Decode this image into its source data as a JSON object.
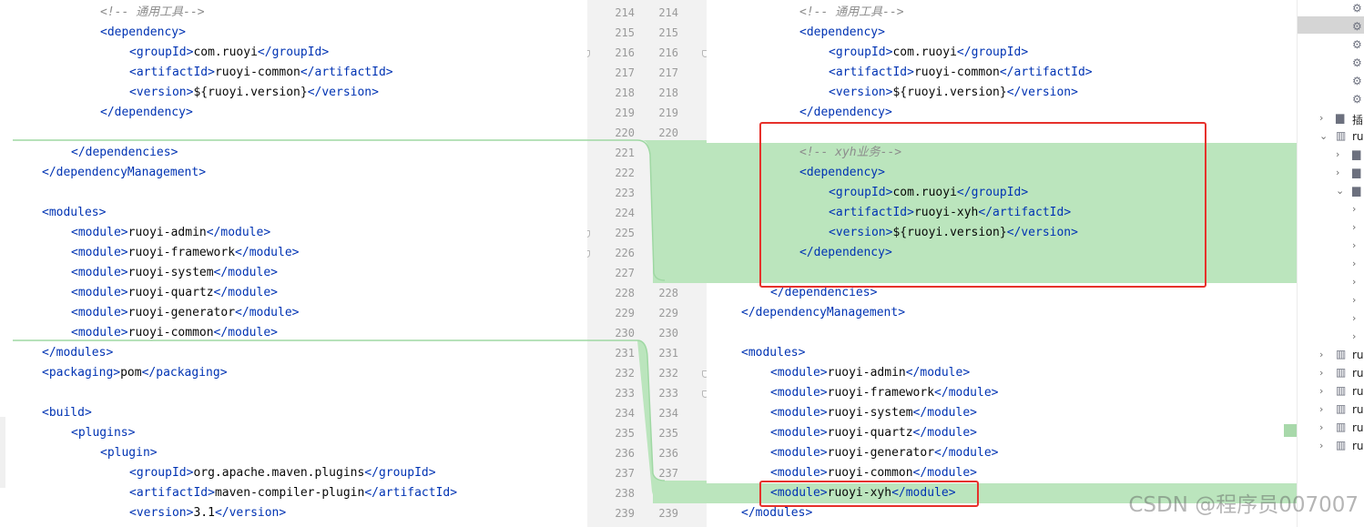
{
  "left_lines": [
    {
      "n": 214,
      "indent": 2,
      "parts": [
        [
          "cm",
          "<!-- 通用工具-->"
        ]
      ]
    },
    {
      "n": 215,
      "indent": 2,
      "parts": [
        [
          "t",
          "<"
        ],
        [
          "t",
          "dependency"
        ],
        [
          "t",
          ">"
        ]
      ]
    },
    {
      "n": 216,
      "indent": 3,
      "parts": [
        [
          "t",
          "<"
        ],
        [
          "t",
          "groupId"
        ],
        [
          "t",
          ">"
        ],
        [
          "p",
          "com.ruoyi"
        ],
        [
          "t",
          "</"
        ],
        [
          "t",
          "groupId"
        ],
        [
          "t",
          ">"
        ]
      ]
    },
    {
      "n": 217,
      "indent": 3,
      "parts": [
        [
          "t",
          "<"
        ],
        [
          "t",
          "artifactId"
        ],
        [
          "t",
          ">"
        ],
        [
          "p",
          "ruoyi-common"
        ],
        [
          "t",
          "</"
        ],
        [
          "t",
          "artifactId"
        ],
        [
          "t",
          ">"
        ]
      ]
    },
    {
      "n": 218,
      "indent": 3,
      "parts": [
        [
          "t",
          "<"
        ],
        [
          "t",
          "version"
        ],
        [
          "t",
          ">"
        ],
        [
          "p",
          "${ruoyi.version}"
        ],
        [
          "t",
          "</"
        ],
        [
          "t",
          "version"
        ],
        [
          "t",
          ">"
        ]
      ]
    },
    {
      "n": 219,
      "indent": 2,
      "parts": [
        [
          "t",
          "</"
        ],
        [
          "t",
          "dependency"
        ],
        [
          "t",
          ">"
        ]
      ]
    },
    {
      "n": 220,
      "indent": 0,
      "parts": []
    },
    {
      "n": 221,
      "indent": 1,
      "parts": [
        [
          "t",
          "</"
        ],
        [
          "t",
          "dependencies"
        ],
        [
          "t",
          ">"
        ]
      ]
    },
    {
      "n": 222,
      "indent": 0,
      "parts": [
        [
          "t",
          "</"
        ],
        [
          "t",
          "dependencyManagement"
        ],
        [
          "t",
          ">"
        ]
      ]
    },
    {
      "n": 223,
      "indent": 0,
      "parts": []
    },
    {
      "n": 224,
      "indent": 0,
      "parts": [
        [
          "t",
          "<"
        ],
        [
          "t",
          "modules"
        ],
        [
          "t",
          ">"
        ]
      ]
    },
    {
      "n": 225,
      "indent": 1,
      "parts": [
        [
          "t",
          "<"
        ],
        [
          "t",
          "module"
        ],
        [
          "t",
          ">"
        ],
        [
          "p",
          "ruoyi-admin"
        ],
        [
          "t",
          "</"
        ],
        [
          "t",
          "module"
        ],
        [
          "t",
          ">"
        ]
      ]
    },
    {
      "n": 226,
      "indent": 1,
      "parts": [
        [
          "t",
          "<"
        ],
        [
          "t",
          "module"
        ],
        [
          "t",
          ">"
        ],
        [
          "p",
          "ruoyi-framework"
        ],
        [
          "t",
          "</"
        ],
        [
          "t",
          "module"
        ],
        [
          "t",
          ">"
        ]
      ]
    },
    {
      "n": 227,
      "indent": 1,
      "parts": [
        [
          "t",
          "<"
        ],
        [
          "t",
          "module"
        ],
        [
          "t",
          ">"
        ],
        [
          "p",
          "ruoyi-system"
        ],
        [
          "t",
          "</"
        ],
        [
          "t",
          "module"
        ],
        [
          "t",
          ">"
        ]
      ]
    },
    {
      "n": 228,
      "indent": 1,
      "parts": [
        [
          "t",
          "<"
        ],
        [
          "t",
          "module"
        ],
        [
          "t",
          ">"
        ],
        [
          "p",
          "ruoyi-quartz"
        ],
        [
          "t",
          "</"
        ],
        [
          "t",
          "module"
        ],
        [
          "t",
          ">"
        ]
      ]
    },
    {
      "n": 229,
      "indent": 1,
      "parts": [
        [
          "t",
          "<"
        ],
        [
          "t",
          "module"
        ],
        [
          "t",
          ">"
        ],
        [
          "p",
          "ruoyi-generator"
        ],
        [
          "t",
          "</"
        ],
        [
          "t",
          "module"
        ],
        [
          "t",
          ">"
        ]
      ]
    },
    {
      "n": 230,
      "indent": 1,
      "parts": [
        [
          "t",
          "<"
        ],
        [
          "t",
          "module"
        ],
        [
          "t",
          ">"
        ],
        [
          "p",
          "ruoyi-common"
        ],
        [
          "t",
          "</"
        ],
        [
          "t",
          "module"
        ],
        [
          "t",
          ">"
        ]
      ]
    },
    {
      "n": 231,
      "indent": 0,
      "parts": [
        [
          "t",
          "</"
        ],
        [
          "t",
          "modules"
        ],
        [
          "t",
          ">"
        ]
      ]
    },
    {
      "n": 232,
      "indent": 0,
      "parts": [
        [
          "t",
          "<"
        ],
        [
          "t",
          "packaging"
        ],
        [
          "t",
          ">"
        ],
        [
          "p",
          "pom"
        ],
        [
          "t",
          "</"
        ],
        [
          "t",
          "packaging"
        ],
        [
          "t",
          ">"
        ]
      ]
    },
    {
      "n": 233,
      "indent": 0,
      "parts": []
    },
    {
      "n": 234,
      "indent": 0,
      "parts": [
        [
          "t",
          "<"
        ],
        [
          "t",
          "build"
        ],
        [
          "t",
          ">"
        ]
      ]
    },
    {
      "n": 235,
      "indent": 1,
      "parts": [
        [
          "t",
          "<"
        ],
        [
          "t",
          "plugins"
        ],
        [
          "t",
          ">"
        ]
      ]
    },
    {
      "n": 236,
      "indent": 2,
      "parts": [
        [
          "t",
          "<"
        ],
        [
          "t",
          "plugin"
        ],
        [
          "t",
          ">"
        ]
      ]
    },
    {
      "n": 237,
      "indent": 3,
      "parts": [
        [
          "t",
          "<"
        ],
        [
          "t",
          "groupId"
        ],
        [
          "t",
          ">"
        ],
        [
          "p",
          "org.apache.maven.plugins"
        ],
        [
          "t",
          "</"
        ],
        [
          "t",
          "groupId"
        ],
        [
          "t",
          ">"
        ]
      ]
    },
    {
      "n": 238,
      "indent": 3,
      "parts": [
        [
          "t",
          "<"
        ],
        [
          "t",
          "artifactId"
        ],
        [
          "t",
          ">"
        ],
        [
          "p",
          "maven-compiler-plugin"
        ],
        [
          "t",
          "</"
        ],
        [
          "t",
          "artifactId"
        ],
        [
          "t",
          ">"
        ]
      ]
    },
    {
      "n": 239,
      "indent": 3,
      "parts": [
        [
          "t",
          "<"
        ],
        [
          "t",
          "version"
        ],
        [
          "t",
          ">"
        ],
        [
          "p",
          "3.1"
        ],
        [
          "t",
          "</"
        ],
        [
          "t",
          "version"
        ],
        [
          "t",
          ">"
        ]
      ]
    }
  ],
  "right_lines": [
    {
      "n": 214,
      "indent": 2,
      "parts": [
        [
          "cm",
          "<!-- 通用工具-->"
        ]
      ]
    },
    {
      "n": 215,
      "indent": 2,
      "parts": [
        [
          "t",
          "<"
        ],
        [
          "t",
          "dependency"
        ],
        [
          "t",
          ">"
        ]
      ]
    },
    {
      "n": 216,
      "indent": 3,
      "parts": [
        [
          "t",
          "<"
        ],
        [
          "t",
          "groupId"
        ],
        [
          "t",
          ">"
        ],
        [
          "p",
          "com.ruoyi"
        ],
        [
          "t",
          "</"
        ],
        [
          "t",
          "groupId"
        ],
        [
          "t",
          ">"
        ]
      ]
    },
    {
      "n": 217,
      "indent": 3,
      "parts": [
        [
          "t",
          "<"
        ],
        [
          "t",
          "artifactId"
        ],
        [
          "t",
          ">"
        ],
        [
          "p",
          "ruoyi-common"
        ],
        [
          "t",
          "</"
        ],
        [
          "t",
          "artifactId"
        ],
        [
          "t",
          ">"
        ]
      ]
    },
    {
      "n": 218,
      "indent": 3,
      "parts": [
        [
          "t",
          "<"
        ],
        [
          "t",
          "version"
        ],
        [
          "t",
          ">"
        ],
        [
          "p",
          "${ruoyi.version}"
        ],
        [
          "t",
          "</"
        ],
        [
          "t",
          "version"
        ],
        [
          "t",
          ">"
        ]
      ]
    },
    {
      "n": 219,
      "indent": 2,
      "parts": [
        [
          "t",
          "</"
        ],
        [
          "t",
          "dependency"
        ],
        [
          "t",
          ">"
        ]
      ]
    },
    {
      "n": 220,
      "indent": 0,
      "parts": []
    },
    {
      "n": 221,
      "indent": 2,
      "parts": [
        [
          "cm",
          "<!-- xyh业务-->"
        ]
      ]
    },
    {
      "n": 222,
      "indent": 2,
      "parts": [
        [
          "t",
          "<"
        ],
        [
          "t",
          "dependency"
        ],
        [
          "t",
          ">"
        ]
      ]
    },
    {
      "n": 223,
      "indent": 3,
      "parts": [
        [
          "t",
          "<"
        ],
        [
          "t",
          "groupId"
        ],
        [
          "t",
          ">"
        ],
        [
          "p",
          "com.ruoyi"
        ],
        [
          "t",
          "</"
        ],
        [
          "t",
          "groupId"
        ],
        [
          "t",
          ">"
        ]
      ]
    },
    {
      "n": 224,
      "indent": 3,
      "parts": [
        [
          "t",
          "<"
        ],
        [
          "t",
          "artifactId"
        ],
        [
          "t",
          ">"
        ],
        [
          "p",
          "ruoyi-xyh"
        ],
        [
          "t",
          "</"
        ],
        [
          "t",
          "artifactId"
        ],
        [
          "t",
          ">"
        ]
      ]
    },
    {
      "n": 225,
      "indent": 3,
      "parts": [
        [
          "t",
          "<"
        ],
        [
          "t",
          "version"
        ],
        [
          "t",
          ">"
        ],
        [
          "p",
          "${ruoyi.version}"
        ],
        [
          "t",
          "</"
        ],
        [
          "t",
          "version"
        ],
        [
          "t",
          ">"
        ]
      ]
    },
    {
      "n": 226,
      "indent": 2,
      "parts": [
        [
          "t",
          "</"
        ],
        [
          "t",
          "dependency"
        ],
        [
          "t",
          ">"
        ]
      ]
    },
    {
      "n": 227,
      "indent": 0,
      "parts": []
    },
    {
      "n": 228,
      "indent": 1,
      "parts": [
        [
          "t",
          "</"
        ],
        [
          "t",
          "dependencies"
        ],
        [
          "t",
          ">"
        ]
      ]
    },
    {
      "n": 229,
      "indent": 0,
      "parts": [
        [
          "t",
          "</"
        ],
        [
          "t",
          "dependencyManagement"
        ],
        [
          "t",
          ">"
        ]
      ]
    },
    {
      "n": 230,
      "indent": 0,
      "parts": []
    },
    {
      "n": 231,
      "indent": 0,
      "parts": [
        [
          "t",
          "<"
        ],
        [
          "t",
          "modules"
        ],
        [
          "t",
          ">"
        ]
      ]
    },
    {
      "n": 232,
      "indent": 1,
      "parts": [
        [
          "t",
          "<"
        ],
        [
          "t",
          "module"
        ],
        [
          "t",
          ">"
        ],
        [
          "p",
          "ruoyi-admin"
        ],
        [
          "t",
          "</"
        ],
        [
          "t",
          "module"
        ],
        [
          "t",
          ">"
        ]
      ]
    },
    {
      "n": 233,
      "indent": 1,
      "parts": [
        [
          "t",
          "<"
        ],
        [
          "t",
          "module"
        ],
        [
          "t",
          ">"
        ],
        [
          "p",
          "ruoyi-framework"
        ],
        [
          "t",
          "</"
        ],
        [
          "t",
          "module"
        ],
        [
          "t",
          ">"
        ]
      ]
    },
    {
      "n": 234,
      "indent": 1,
      "parts": [
        [
          "t",
          "<"
        ],
        [
          "t",
          "module"
        ],
        [
          "t",
          ">"
        ],
        [
          "p",
          "ruoyi-system"
        ],
        [
          "t",
          "</"
        ],
        [
          "t",
          "module"
        ],
        [
          "t",
          ">"
        ]
      ]
    },
    {
      "n": 235,
      "indent": 1,
      "parts": [
        [
          "t",
          "<"
        ],
        [
          "t",
          "module"
        ],
        [
          "t",
          ">"
        ],
        [
          "p",
          "ruoyi-quartz"
        ],
        [
          "t",
          "</"
        ],
        [
          "t",
          "module"
        ],
        [
          "t",
          ">"
        ]
      ]
    },
    {
      "n": 236,
      "indent": 1,
      "parts": [
        [
          "t",
          "<"
        ],
        [
          "t",
          "module"
        ],
        [
          "t",
          ">"
        ],
        [
          "p",
          "ruoyi-generator"
        ],
        [
          "t",
          "</"
        ],
        [
          "t",
          "module"
        ],
        [
          "t",
          ">"
        ]
      ]
    },
    {
      "n": 237,
      "indent": 1,
      "parts": [
        [
          "t",
          "<"
        ],
        [
          "t",
          "module"
        ],
        [
          "t",
          ">"
        ],
        [
          "p",
          "ruoyi-common"
        ],
        [
          "t",
          "</"
        ],
        [
          "t",
          "module"
        ],
        [
          "t",
          ">"
        ]
      ]
    },
    {
      "n": 238,
      "indent": 1,
      "parts": [
        [
          "t",
          "<"
        ],
        [
          "t",
          "module"
        ],
        [
          "t",
          ">"
        ],
        [
          "p",
          "ruoyi-xyh"
        ],
        [
          "t",
          "</"
        ],
        [
          "t",
          "module"
        ],
        [
          "t",
          ">"
        ]
      ]
    },
    {
      "n": 239,
      "indent": 0,
      "parts": [
        [
          "t",
          "</"
        ],
        [
          "t",
          "modules"
        ],
        [
          "t",
          ">"
        ]
      ]
    }
  ],
  "gutter": {
    "left_numbers": [
      214,
      215,
      216,
      217,
      218,
      219,
      220,
      221,
      222,
      223,
      224,
      225,
      226,
      227,
      228,
      229,
      230,
      231,
      232,
      233,
      234,
      235,
      236,
      237,
      238,
      239
    ],
    "right_numbers": [
      214,
      215,
      216,
      217,
      218,
      219,
      220,
      221,
      222,
      223,
      224,
      225,
      226,
      227,
      228,
      229,
      230,
      231,
      232,
      233,
      234,
      235,
      236,
      237,
      238,
      239
    ]
  },
  "diff": {
    "inserted_right_lines": [
      221,
      222,
      223,
      224,
      225,
      226,
      227,
      238
    ],
    "highlight_color": "#bbe5bd"
  },
  "side_panel": {
    "items": [
      {
        "arrow": "",
        "icon": "gear-icon",
        "label": ""
      },
      {
        "arrow": "",
        "icon": "gear-icon",
        "label": ""
      },
      {
        "arrow": "",
        "icon": "gear-icon",
        "label": ""
      },
      {
        "arrow": "",
        "icon": "gear-icon",
        "label": ""
      },
      {
        "arrow": "",
        "icon": "gear-icon",
        "label": ""
      },
      {
        "arrow": "",
        "icon": "gear-icon",
        "label": ""
      },
      {
        "arrow": ">",
        "icon": "folder-icon",
        "label": "插"
      },
      {
        "arrow": "v",
        "icon": "module-icon",
        "label": "ru"
      },
      {
        "arrow": ">",
        "icon": "folder-icon",
        "label": ""
      },
      {
        "arrow": ">",
        "icon": "folder-icon",
        "label": ""
      },
      {
        "arrow": "v",
        "icon": "folder-icon",
        "label": ""
      },
      {
        "arrow": ">",
        "icon": "",
        "label": ""
      },
      {
        "arrow": ">",
        "icon": "",
        "label": ""
      },
      {
        "arrow": ">",
        "icon": "",
        "label": ""
      },
      {
        "arrow": ">",
        "icon": "",
        "label": ""
      },
      {
        "arrow": ">",
        "icon": "",
        "label": ""
      },
      {
        "arrow": ">",
        "icon": "",
        "label": ""
      },
      {
        "arrow": ">",
        "icon": "",
        "label": ""
      },
      {
        "arrow": ">",
        "icon": "",
        "label": ""
      },
      {
        "arrow": ">",
        "icon": "module-icon",
        "label": "ru"
      },
      {
        "arrow": ">",
        "icon": "module-icon",
        "label": "ru"
      },
      {
        "arrow": ">",
        "icon": "module-icon",
        "label": "ru"
      },
      {
        "arrow": ">",
        "icon": "module-icon",
        "label": "ru"
      },
      {
        "arrow": ">",
        "icon": "module-icon",
        "label": "ru"
      },
      {
        "arrow": ">",
        "icon": "module-icon",
        "label": "ru"
      }
    ]
  },
  "watermark": "CSDN @程序员007007"
}
